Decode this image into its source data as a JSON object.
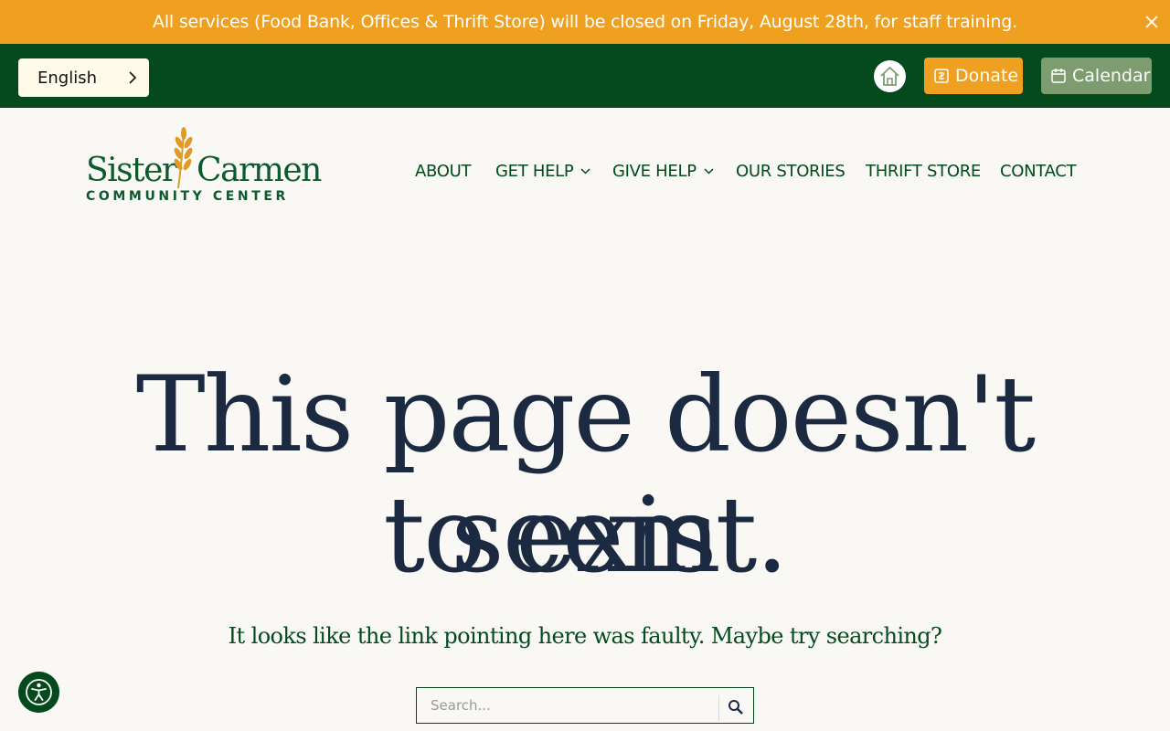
{
  "notice": {
    "text": "All services (Food Bank, Offices & Thrift Store) will be closed on Friday, August 28th, for staff training.",
    "close_icon": "close-icon"
  },
  "topbar": {
    "language": "English",
    "home_icon": "home-icon",
    "donate_label": "Donate",
    "donate_icon": "donate-icon",
    "calendar_label": "Calendar",
    "calendar_icon": "calendar-icon"
  },
  "logo": {
    "word_a": "Sister",
    "word_b": "Carmen",
    "subtitle": "COMMUNITY CENTER"
  },
  "nav": {
    "items": [
      {
        "label": "ABOUT",
        "has_dropdown": false
      },
      {
        "label": "GET HELP",
        "has_dropdown": true
      },
      {
        "label": "GIVE HELP",
        "has_dropdown": true
      },
      {
        "label": "OUR STORIES",
        "has_dropdown": false
      },
      {
        "label": "THRIFT STORE",
        "has_dropdown": false
      },
      {
        "label": "CONTACT",
        "has_dropdown": false
      }
    ]
  },
  "main": {
    "headline_line1": "This page doesn't seem",
    "headline_line2": "to exist.",
    "subtext": "It looks like the link pointing here was faulty. Maybe try searching?",
    "search_placeholder": "Search..."
  },
  "colors": {
    "accent_orange": "#f0a020",
    "brand_green": "#044a1c",
    "calendar_green": "#7d9c70",
    "headline_navy": "#1b2a40",
    "background": "#f9f8f5"
  }
}
